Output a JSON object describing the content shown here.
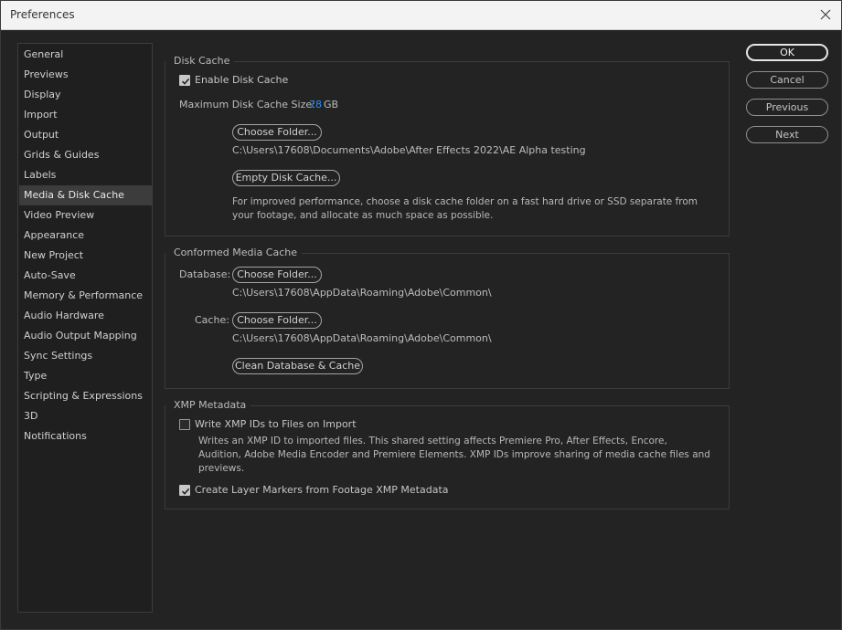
{
  "window": {
    "title": "Preferences"
  },
  "sidebar": {
    "items": [
      {
        "label": "General"
      },
      {
        "label": "Previews"
      },
      {
        "label": "Display"
      },
      {
        "label": "Import"
      },
      {
        "label": "Output"
      },
      {
        "label": "Grids & Guides"
      },
      {
        "label": "Labels"
      },
      {
        "label": "Media & Disk Cache"
      },
      {
        "label": "Video Preview"
      },
      {
        "label": "Appearance"
      },
      {
        "label": "New Project"
      },
      {
        "label": "Auto-Save"
      },
      {
        "label": "Memory & Performance"
      },
      {
        "label": "Audio Hardware"
      },
      {
        "label": "Audio Output Mapping"
      },
      {
        "label": "Sync Settings"
      },
      {
        "label": "Type"
      },
      {
        "label": "Scripting & Expressions"
      },
      {
        "label": "3D"
      },
      {
        "label": "Notifications"
      }
    ],
    "selected": "Media & Disk Cache"
  },
  "disk_cache": {
    "title": "Disk Cache",
    "enable_label": "Enable Disk Cache",
    "enable_checked": true,
    "max_size_label": "Maximum Disk Cache Size:",
    "max_size_value": "78",
    "max_size_unit": "GB",
    "choose_folder_label": "Choose Folder...",
    "folder_path": "C:\\Users\\17608\\Documents\\Adobe\\After Effects 2022\\AE Alpha testing",
    "empty_label": "Empty Disk Cache...",
    "hint": "For improved performance, choose a disk cache folder on a fast hard drive or SSD separate from your footage, and allocate as much space as possible."
  },
  "conformed_cache": {
    "title": "Conformed Media Cache",
    "database_label": "Database:",
    "database_button": "Choose Folder...",
    "database_path": "C:\\Users\\17608\\AppData\\Roaming\\Adobe\\Common\\",
    "cache_label": "Cache:",
    "cache_button": "Choose Folder...",
    "cache_path": "C:\\Users\\17608\\AppData\\Roaming\\Adobe\\Common\\",
    "clean_label": "Clean Database & Cache"
  },
  "xmp": {
    "title": "XMP Metadata",
    "write_label": "Write XMP IDs to Files on Import",
    "write_checked": false,
    "write_desc": "Writes an XMP ID to imported files. This shared setting affects Premiere Pro, After Effects, Encore, Audition, Adobe Media Encoder and Premiere Elements. XMP IDs improve sharing of media cache files and previews.",
    "markers_label": "Create Layer Markers from Footage XMP Metadata",
    "markers_checked": true
  },
  "actions": {
    "ok": "OK",
    "cancel": "Cancel",
    "previous": "Previous",
    "next": "Next"
  },
  "icons": {
    "close": "close-icon",
    "check": "checkmark-icon"
  },
  "colors": {
    "accent": "#2d8ceb",
    "background": "#232323",
    "titlebar": "#f3f3f3"
  }
}
